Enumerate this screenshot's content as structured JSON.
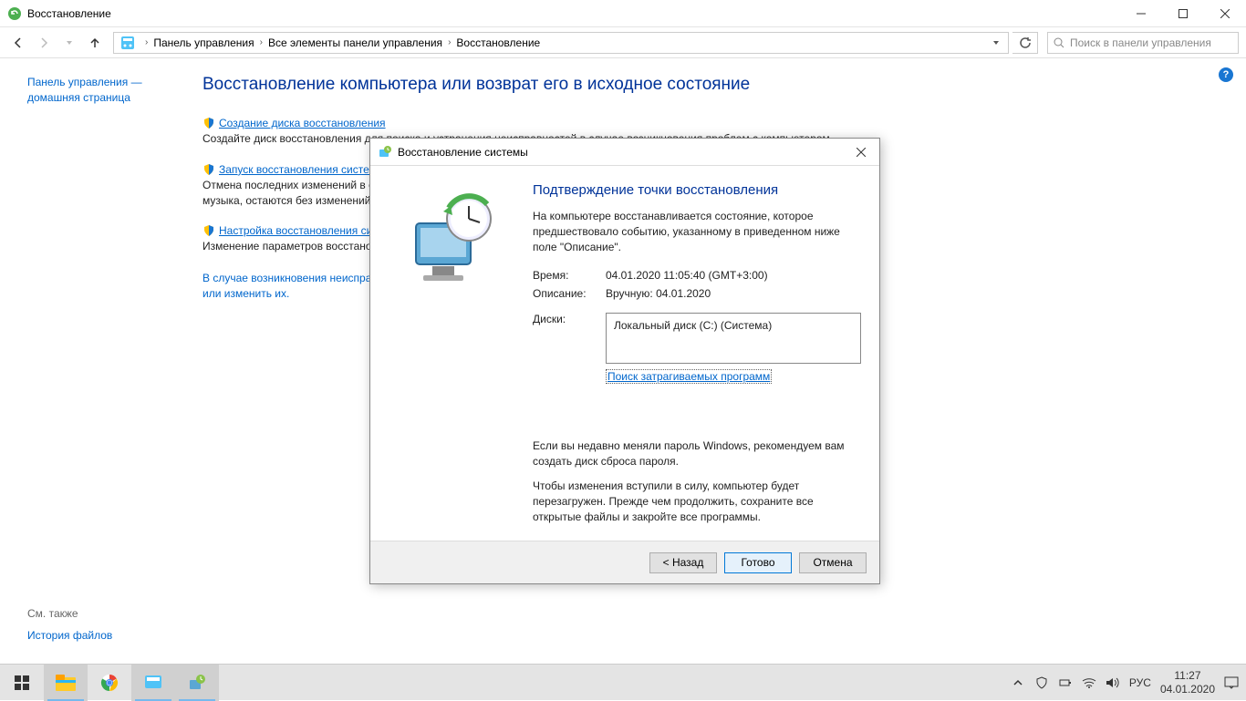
{
  "window": {
    "title": "Восстановление"
  },
  "breadcrumb": {
    "item1": "Панель управления",
    "item2": "Все элементы панели управления",
    "item3": "Восстановление"
  },
  "search": {
    "placeholder": "Поиск в панели управления"
  },
  "sidebar": {
    "home": "Панель управления — домашняя страница",
    "see_also": "См. также",
    "file_history": "История файлов"
  },
  "page": {
    "heading": "Восстановление компьютера или возврат его в исходное состояние",
    "actions": [
      {
        "label": "Создание диска восстановления",
        "desc": "Создайте диск восстановления для поиска и устранения неисправностей в случае возникновения проблем с компьютером."
      },
      {
        "label": "Запуск восстановления системы",
        "desc": "Отмена последних изменений в системе, которые могли вызвать проблемы. При этом ваши файлы (документы, изображения, музыка, остаются без изменений."
      },
      {
        "label": "Настройка восстановления системы",
        "desc": "Изменение параметров восстановления, управление местом на диске, а также создание и удаление точек восстановления."
      }
    ],
    "troubleshoot": "В случае возникновения неисправности компьютера перезагрузите его или изменить их."
  },
  "dialog": {
    "title": "Восстановление системы",
    "heading": "Подтверждение точки восстановления",
    "intro": "На компьютере восстанавливается состояние, которое предшествовало событию, указанному в приведенном ниже поле \"Описание\".",
    "time_label": "Время:",
    "time_value": "04.01.2020 11:05:40 (GMT+3:00)",
    "desc_label": "Описание:",
    "desc_value": "Вручную: 04.01.2020",
    "disks_label": "Диски:",
    "disks_value": "Локальный диск (C:) (Система)",
    "affected": "Поиск затрагиваемых программ",
    "pwd_note": "Если вы недавно меняли пароль Windows, рекомендуем вам создать диск сброса пароля.",
    "warn_note": "Чтобы изменения вступили в силу, компьютер будет перезагружен. Прежде чем продолжить, сохраните все открытые файлы и закройте все программы.",
    "back": "< Назад",
    "finish": "Готово",
    "cancel": "Отмена"
  },
  "tray": {
    "lang": "РУС",
    "time": "11:27",
    "date": "04.01.2020"
  }
}
